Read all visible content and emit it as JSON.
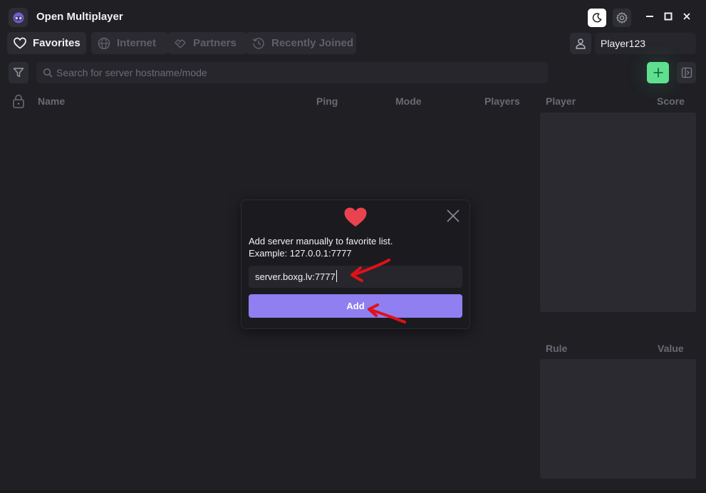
{
  "app": {
    "title": "Open Multiplayer"
  },
  "tabs": [
    {
      "label": "Favorites",
      "icon": "heart-icon",
      "active": true
    },
    {
      "label": "Internet",
      "icon": "globe-icon",
      "active": false
    },
    {
      "label": "Partners",
      "icon": "handshake-icon",
      "active": false
    },
    {
      "label": "Recently Joined",
      "icon": "history-icon",
      "active": false
    }
  ],
  "user": {
    "nickname": "Player123"
  },
  "search": {
    "placeholder": "Search for server hostname/mode"
  },
  "server_table": {
    "columns": [
      "Name",
      "Ping",
      "Mode",
      "Players"
    ]
  },
  "player_panel": {
    "columns": [
      "Player",
      "Score"
    ]
  },
  "rules_panel": {
    "columns": [
      "Rule",
      "Value"
    ]
  },
  "dialog": {
    "message_line1": "Add server manually to favorite list.",
    "message_line2": "Example: 127.0.0.1:7777",
    "input_value": "server.boxg.lv:7777",
    "add_label": "Add"
  },
  "colors": {
    "background": "#1f1f24",
    "accent_purple": "#8f7ff0",
    "add_green": "#5ee08f",
    "heart_red": "#e8434f",
    "annotation_red": "#e0111a"
  }
}
